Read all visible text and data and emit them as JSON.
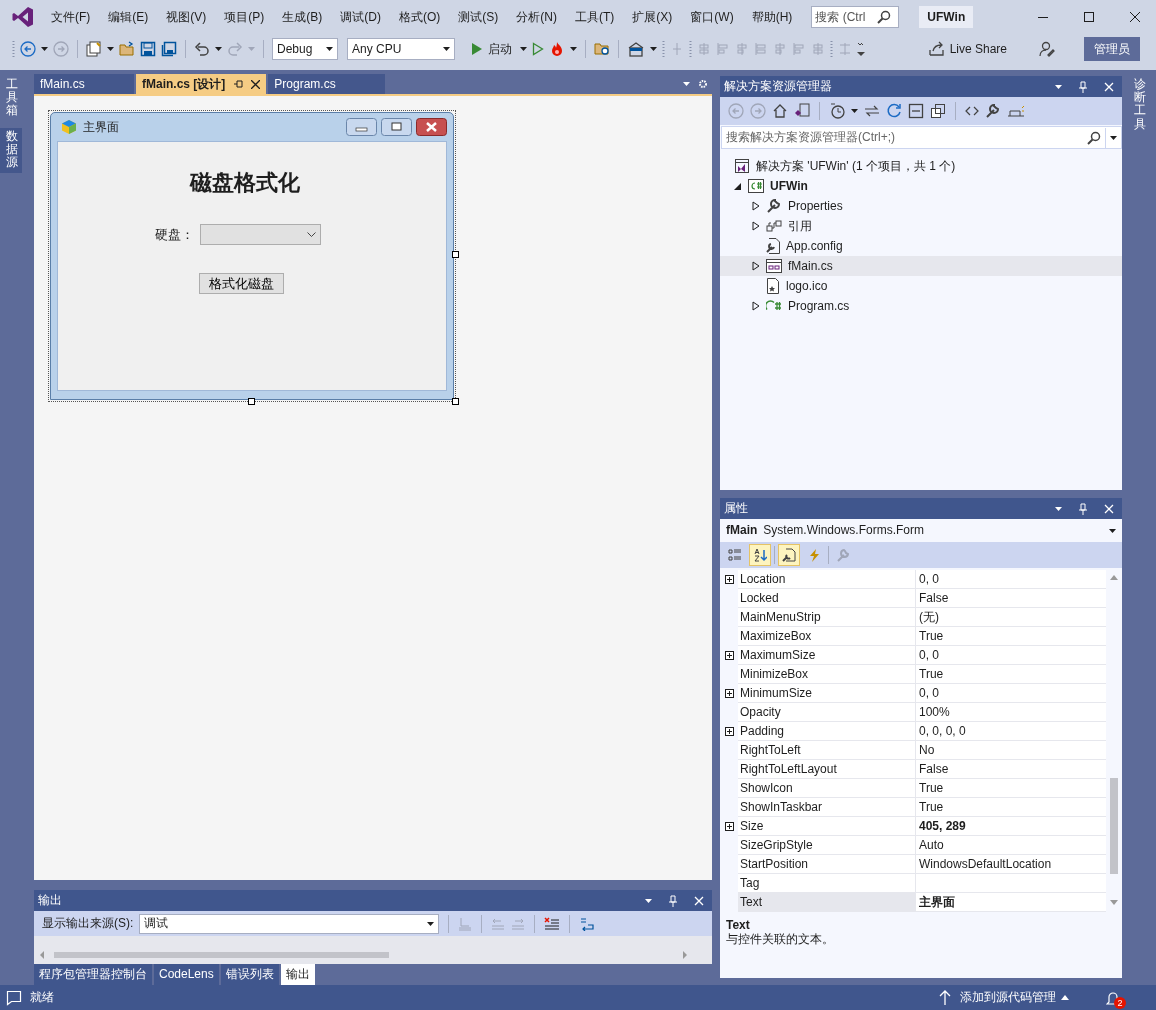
{
  "menu_bar": {
    "items": [
      "文件(F)",
      "编辑(E)",
      "视图(V)",
      "项目(P)",
      "生成(B)",
      "调试(D)",
      "格式(O)",
      "测试(S)",
      "分析(N)",
      "工具(T)",
      "扩展(X)",
      "窗口(W)",
      "帮助(H)"
    ],
    "search": {
      "placeholder": "搜索 (Ctrl"
    },
    "solution_name": "UFWin"
  },
  "toolbar": {
    "configuration": "Debug",
    "platform": "Any CPU",
    "start": "启动",
    "live_share": "Live Share",
    "account": "管理员"
  },
  "left_tabs": [
    {
      "label": "工具箱",
      "selected": false
    },
    {
      "label": "数据源",
      "selected": true
    }
  ],
  "right_tabs": [
    {
      "label": "诊断工具",
      "selected": false
    }
  ],
  "document_tabs": [
    {
      "label": "fMain.cs",
      "selected": false
    },
    {
      "label": "fMain.cs [设计]",
      "selected": true
    },
    {
      "label": "Program.cs",
      "selected": false
    }
  ],
  "designer": {
    "form_title": "主界面",
    "heading": "磁盘格式化",
    "disk_label": "硬盘：",
    "format_button": "格式化磁盘"
  },
  "solution_explorer": {
    "title": "解决方案资源管理器",
    "search": {
      "placeholder": "搜索解决方案资源管理器(Ctrl+;)"
    },
    "tree": [
      {
        "label": "解决方案 'UFWin' (1 个项目，共 1 个)",
        "kind": "solution",
        "selected": false,
        "children": [
          {
            "label": "UFWin",
            "kind": "project",
            "expanded": true,
            "selected": false,
            "children": [
              {
                "label": "Properties",
                "kind": "properties",
                "expanded": false,
                "selected": false
              },
              {
                "label": "引用",
                "kind": "references",
                "expanded": false,
                "selected": false
              },
              {
                "label": "App.config",
                "kind": "config",
                "selected": false
              },
              {
                "label": "fMain.cs",
                "kind": "form",
                "expanded": false,
                "selected": true
              },
              {
                "label": "logo.ico",
                "kind": "icon-file",
                "selected": false
              },
              {
                "label": "Program.cs",
                "kind": "csharp",
                "expanded": false,
                "selected": false
              }
            ]
          }
        ]
      }
    ]
  },
  "properties": {
    "title": "属性",
    "object_name": "fMain",
    "object_type": "System.Windows.Forms.Form",
    "buttons": [
      {
        "kind": "categorized",
        "selected": false,
        "disabled": false
      },
      {
        "kind": "alphabetical",
        "selected": true,
        "disabled": false
      },
      {
        "kind": "properties",
        "selected": true,
        "disabled": false
      },
      {
        "kind": "events",
        "selected": false,
        "disabled": false
      },
      {
        "kind": "property-pages",
        "selected": false,
        "disabled": true
      }
    ],
    "rows": [
      {
        "name": "Location",
        "value": "0, 0",
        "expanded": false,
        "modified": false,
        "selected": false
      },
      {
        "name": "Locked",
        "value": "False",
        "modified": false,
        "selected": false
      },
      {
        "name": "MainMenuStrip",
        "value": "(无)",
        "modified": false,
        "selected": false
      },
      {
        "name": "MaximizeBox",
        "value": "True",
        "modified": false,
        "selected": false
      },
      {
        "name": "MaximumSize",
        "value": "0, 0",
        "expanded": false,
        "modified": false,
        "selected": false
      },
      {
        "name": "MinimizeBox",
        "value": "True",
        "modified": false,
        "selected": false
      },
      {
        "name": "MinimumSize",
        "value": "0, 0",
        "expanded": false,
        "modified": false,
        "selected": false
      },
      {
        "name": "Opacity",
        "value": "100%",
        "modified": false,
        "selected": false
      },
      {
        "name": "Padding",
        "value": "0, 0, 0, 0",
        "expanded": false,
        "modified": false,
        "selected": false
      },
      {
        "name": "RightToLeft",
        "value": "No",
        "modified": false,
        "selected": false
      },
      {
        "name": "RightToLeftLayout",
        "value": "False",
        "modified": false,
        "selected": false
      },
      {
        "name": "ShowIcon",
        "value": "True",
        "modified": false,
        "selected": false
      },
      {
        "name": "ShowInTaskbar",
        "value": "True",
        "modified": false,
        "selected": false
      },
      {
        "name": "Size",
        "value": "405, 289",
        "expanded": false,
        "modified": true,
        "selected": false
      },
      {
        "name": "SizeGripStyle",
        "value": "Auto",
        "modified": false,
        "selected": false
      },
      {
        "name": "StartPosition",
        "value": "WindowsDefaultLocation",
        "modified": false,
        "selected": false
      },
      {
        "name": "Tag",
        "selected": false
      },
      {
        "name": "Text",
        "value": "主界面",
        "modified": true,
        "selected": true
      }
    ],
    "description": {
      "title": "Text",
      "text": "与控件关联的文本。"
    }
  },
  "output": {
    "title": "输出",
    "source_label": "显示输出来源(S):",
    "source": "调试",
    "tabs": [
      {
        "label": "程序包管理器控制台",
        "selected": false
      },
      {
        "label": "CodeLens",
        "selected": false
      },
      {
        "label": "错误列表",
        "selected": false
      },
      {
        "label": "输出",
        "selected": true
      }
    ]
  },
  "status_bar": {
    "message": "就绪",
    "source_control": "添加到源代码管理",
    "notifications": "2"
  }
}
